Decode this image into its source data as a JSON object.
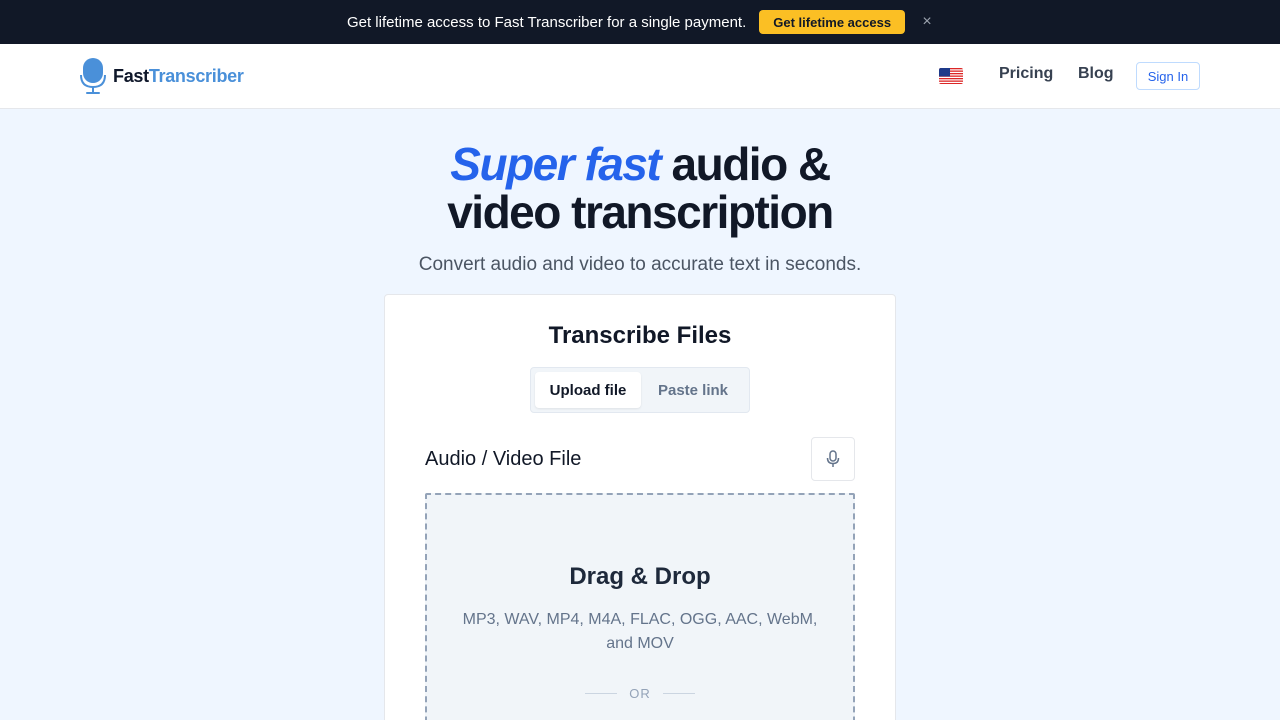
{
  "promo": {
    "text": "Get lifetime access to Fast Transcriber for a single payment.",
    "button_label": "Get lifetime access",
    "close_label": "×"
  },
  "header": {
    "logo_part1": "Fast",
    "logo_part2": "Transcriber",
    "language_flag": "us-flag-icon",
    "nav": {
      "pricing": "Pricing",
      "blog": "Blog"
    },
    "signin_label": "Sign In"
  },
  "hero": {
    "title_accent": "Super fast",
    "title_rest_line1": " audio &",
    "title_line2": "video transcription",
    "subtitle": "Convert audio and video to accurate text in seconds."
  },
  "card": {
    "title": "Transcribe Files",
    "tabs": [
      {
        "label": "Upload file",
        "active": true
      },
      {
        "label": "Paste link",
        "active": false
      }
    ],
    "field_label": "Audio / Video File",
    "mic_icon": "microphone-icon",
    "dropzone": {
      "title": "Drag & Drop",
      "formats": "MP3, WAV, MP4, M4A, FLAC, OGG, AAC, WebM, and MOV",
      "or_label": "OR"
    }
  },
  "colors": {
    "accent": "#2563eb",
    "promo_bg": "#111827",
    "promo_button": "#fbbf24",
    "page_bg": "#eff6ff"
  }
}
